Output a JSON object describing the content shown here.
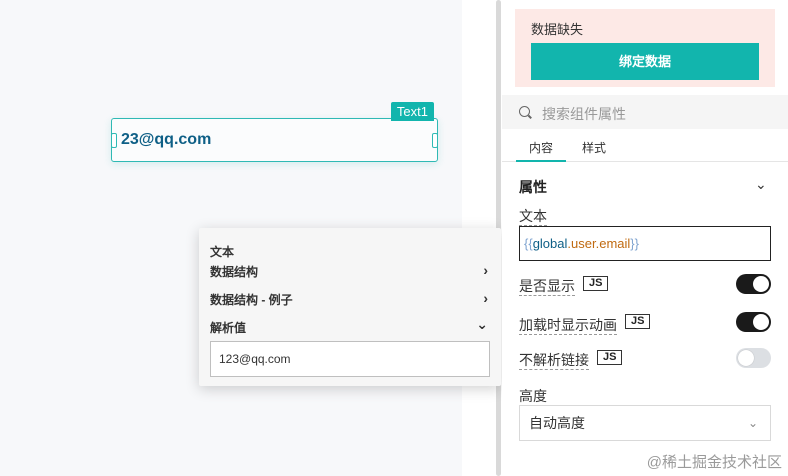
{
  "canvas": {
    "component": {
      "tag": "Text1",
      "value": "23@qq.com"
    }
  },
  "popover": {
    "title": "文本",
    "rows": [
      {
        "label": "数据结构",
        "chevron": "›"
      },
      {
        "label": "数据结构 - 例子",
        "chevron": "›"
      },
      {
        "label": "解析值",
        "chevron": "⌄"
      }
    ],
    "parsed_value": "123@qq.com"
  },
  "panel": {
    "warning": {
      "text": "数据缺失",
      "button_label": "绑定数据"
    },
    "search": {
      "placeholder": "搜索组件属性"
    },
    "tabs": [
      {
        "label": "内容",
        "active": true
      },
      {
        "label": "样式",
        "active": false
      }
    ],
    "section": {
      "title": "属性",
      "chevron": "⌄"
    },
    "text_field": {
      "label": "文本",
      "open": "{{",
      "obj": "global",
      "dot1": ".",
      "prop1": "user",
      "dot2": ".",
      "prop2": "email",
      "close": "}}"
    },
    "props": [
      {
        "label": "是否显示",
        "badge": "JS",
        "on": true
      },
      {
        "label": "加载时显示动画",
        "badge": "JS",
        "on": true
      },
      {
        "label": "不解析链接",
        "badge": "JS",
        "on": false
      }
    ],
    "height": {
      "label": "高度",
      "value": "自动高度",
      "chevron": "⌄"
    }
  },
  "watermark": "@稀土掘金技术社区",
  "colors": {
    "accent": "#12b5ad",
    "warning_bg": "#fde9e6",
    "value_text": "#0e5f86",
    "toggle_on": "#1a1a1a"
  }
}
